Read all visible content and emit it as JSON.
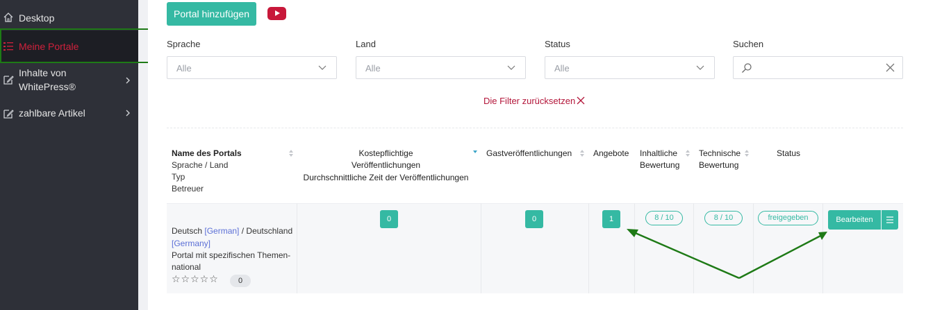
{
  "sidebar": {
    "items": [
      {
        "label": "Desktop",
        "icon": "home-icon"
      },
      {
        "label": "Meine Portale",
        "icon": "list-icon",
        "active": true
      },
      {
        "label": "Inhalte von WhitePress®",
        "icon": "edit-icon"
      },
      {
        "label": "zahlbare Artikel",
        "icon": "edit-icon"
      }
    ]
  },
  "toolbar": {
    "add_label": "Portal hinzufügen",
    "video_icon": "youtube-icon"
  },
  "filters": {
    "sprache": {
      "label": "Sprache",
      "value": "Alle"
    },
    "land": {
      "label": "Land",
      "value": "Alle"
    },
    "status": {
      "label": "Status",
      "value": "Alle"
    },
    "suchen": {
      "label": "Suchen",
      "value": ""
    },
    "reset_label": "Die Filter zurücksetzen"
  },
  "table": {
    "headers": {
      "name": [
        "Name des Portals",
        "Sprache / Land",
        "Typ",
        "Betreuer"
      ],
      "paid_a": "Kostepflichtige",
      "paid_b": "Veröffentlichungen",
      "paid_c": "Durchschnittliche Zeit der Veröffentlichungen",
      "guest": "Gastveröffentlichungen",
      "offers": "Angebote",
      "content_a": "Inhaltliche",
      "content_b": "Bewertung",
      "tech_a": "Technische",
      "tech_b": "Bewertung",
      "status": "Status"
    },
    "rows": [
      {
        "lang": "Deutsch",
        "lang_link": "[German]",
        "sep": "/ Deutschland",
        "country_link": "[Germany]",
        "type_a": "Portal mit spezifischen Themen-",
        "type_b": "national",
        "stars": "☆☆☆☆☆",
        "rating_count": "0",
        "paid": "0",
        "guest": "0",
        "offers": "1",
        "content_score": "8 / 10",
        "tech_score": "8 / 10",
        "status": "freigegeben",
        "edit_label": "Bearbeiten"
      }
    ]
  },
  "colors": {
    "accent": "#35b9a3",
    "danger": "#b3163a",
    "annotation": "#1e7a16",
    "sidebar": "#2e3038"
  }
}
